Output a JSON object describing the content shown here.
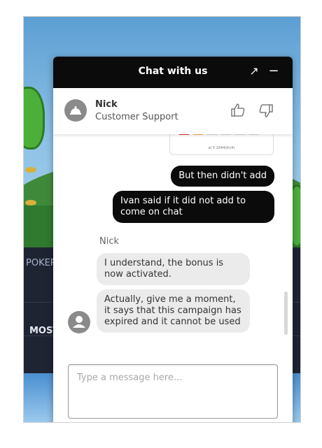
{
  "background": {
    "nav_labels": [
      "POKER",
      "MOST"
    ]
  },
  "chat": {
    "title": "Chat with us",
    "expand_icon": "↗",
    "minimize_icon": "−",
    "agent": {
      "name": "Nick",
      "role": "Customer Support"
    },
    "card_image_caption": "ei 5 1644(0r/4)",
    "messages": [
      {
        "from": "user",
        "text": "But then didn't add"
      },
      {
        "from": "user",
        "text": "Ivan said if it did not add to come on chat"
      },
      {
        "from": "agent",
        "text": "I understand, the bonus is now activated."
      },
      {
        "from": "agent",
        "text": "Actually, give me a moment, it says that this campaign has expired and it cannot be used"
      }
    ],
    "sender_label": "Nick",
    "input_placeholder": "Type a message here..."
  },
  "colors": {
    "header_bg": "#0b0b0b",
    "user_bubble": "#0b0b0b",
    "agent_bubble": "#ebebeb"
  },
  "icons": {
    "thumbs_up": "thumbs-up-icon",
    "thumbs_down": "thumbs-down-icon",
    "share": "share-icon",
    "attach": "paperclip-icon",
    "more": "more-icon"
  }
}
